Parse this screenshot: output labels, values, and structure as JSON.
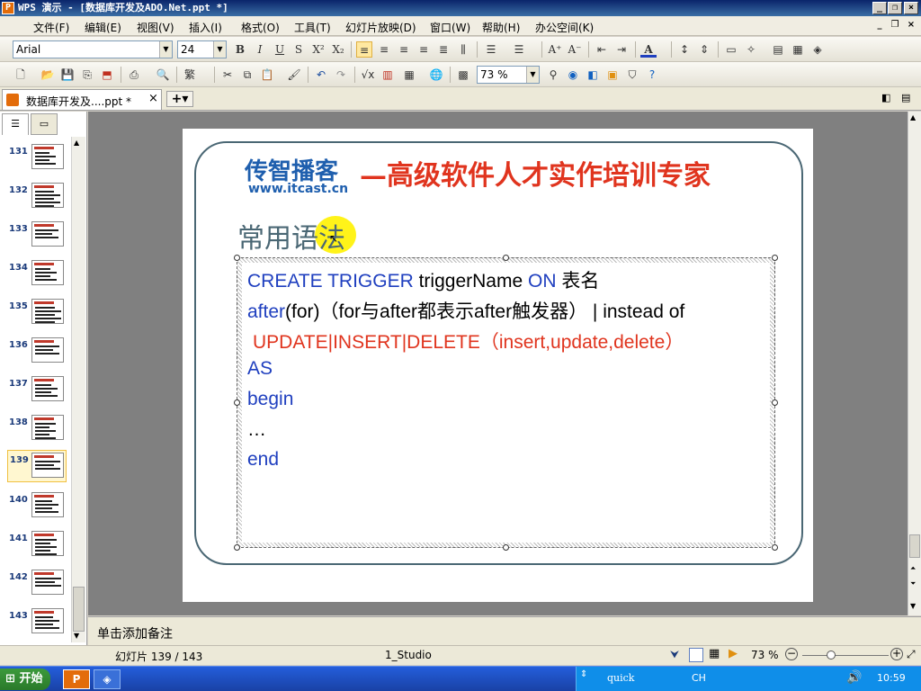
{
  "window": {
    "title": "WPS 演示 - [数据库开发及ADO.Net.ppt *]",
    "app_icon": "P"
  },
  "menu": [
    "文件(F)",
    "编辑(E)",
    "视图(V)",
    "插入(I)",
    "格式(O)",
    "工具(T)",
    "幻灯片放映(D)",
    "窗口(W)",
    "帮助(H)",
    "办公空间(K)"
  ],
  "toolbar": {
    "font": "Arial",
    "size": "24",
    "zoom": "73 %"
  },
  "tab": {
    "name": "数据库开发及....ppt *"
  },
  "thumbnails": [
    "131",
    "132",
    "133",
    "134",
    "135",
    "136",
    "137",
    "138",
    "139",
    "140",
    "141",
    "142",
    "143"
  ],
  "slide": {
    "logo_cn": "传智播客",
    "logo_url": "www.itcast.cn",
    "slogan": "—高级软件人才实作培训专家",
    "heading": "常用语法",
    "code": {
      "l1a": "CREATE TRIGGER",
      "l1b": "triggerName",
      "l1c": "ON",
      "l1d": "表名",
      "l2a": "after",
      "l2b": "(for)（for与after都表示after触发器） | instead of",
      "l3": "UPDATE|INSERT|DELETE（insert,update,delete）",
      "l4": "AS",
      "l5": "begin",
      "l6": "…",
      "l7": "end"
    }
  },
  "notes_placeholder": "单击添加备注",
  "status": {
    "slide": "幻灯片 139 / 143",
    "template": "1_Studio",
    "zoom": "73 %"
  },
  "taskbar": {
    "start": "开始",
    "ime": "quick",
    "lang": "CH",
    "time": "10:59"
  },
  "colors": {
    "keyword": "#1f3fbf",
    "red": "#e0341e",
    "frame": "#4a6774"
  }
}
